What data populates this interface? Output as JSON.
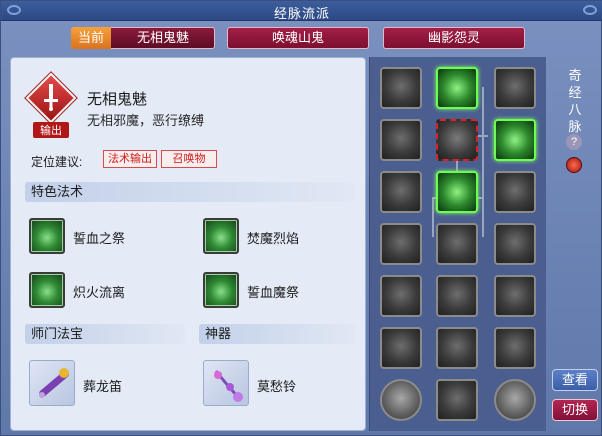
{
  "window": {
    "title": "经脉流派"
  },
  "tabs": {
    "current_tag": "当前",
    "items": [
      {
        "label": "无相鬼魅"
      },
      {
        "label": "唤魂山鬼"
      },
      {
        "label": "幽影怨灵"
      }
    ]
  },
  "character": {
    "role_badge": "输出",
    "name": "无相鬼魅",
    "desc": "无相邪魔，恶行缭缚"
  },
  "position": {
    "label": "定位建议:",
    "tags": [
      "法术输出",
      "召唤物"
    ]
  },
  "sections": {
    "special_skills": "特色法术",
    "sect_treasure": "师门法宝",
    "artifact": "神器"
  },
  "skills": [
    {
      "label": "誓血之祭",
      "icon": "blood-oath-icon"
    },
    {
      "label": "焚魔烈焰",
      "icon": "demon-flame-icon"
    },
    {
      "label": "炽火流离",
      "icon": "blazing-fire-icon"
    },
    {
      "label": "誓血魔祭",
      "icon": "blood-demon-rite-icon"
    }
  ],
  "treasures": [
    {
      "label": "葬龙笛",
      "icon": "dragon-flute-icon"
    },
    {
      "label": "莫愁铃",
      "icon": "bell-icon"
    }
  ],
  "meridian_grid": {
    "rows": [
      [
        "meridian-node",
        "meridian-node-active",
        "meridian-node"
      ],
      [
        "meridian-node",
        "meridian-node-selected",
        "meridian-node-active"
      ],
      [
        "meridian-node",
        "meridian-node-active",
        "meridian-node"
      ],
      [
        "meridian-node",
        "meridian-node",
        "meridian-node"
      ],
      [
        "meridian-node",
        "meridian-node",
        "meridian-node"
      ],
      [
        "meridian-node",
        "meridian-node",
        "meridian-node"
      ],
      [
        "meridian-node",
        "meridian-node",
        "meridian-node"
      ]
    ]
  },
  "side": {
    "vertical_title": [
      "奇",
      "经",
      "八",
      "脉"
    ],
    "help_icon": "?",
    "view_button": "查看",
    "switch_button": "切换"
  }
}
